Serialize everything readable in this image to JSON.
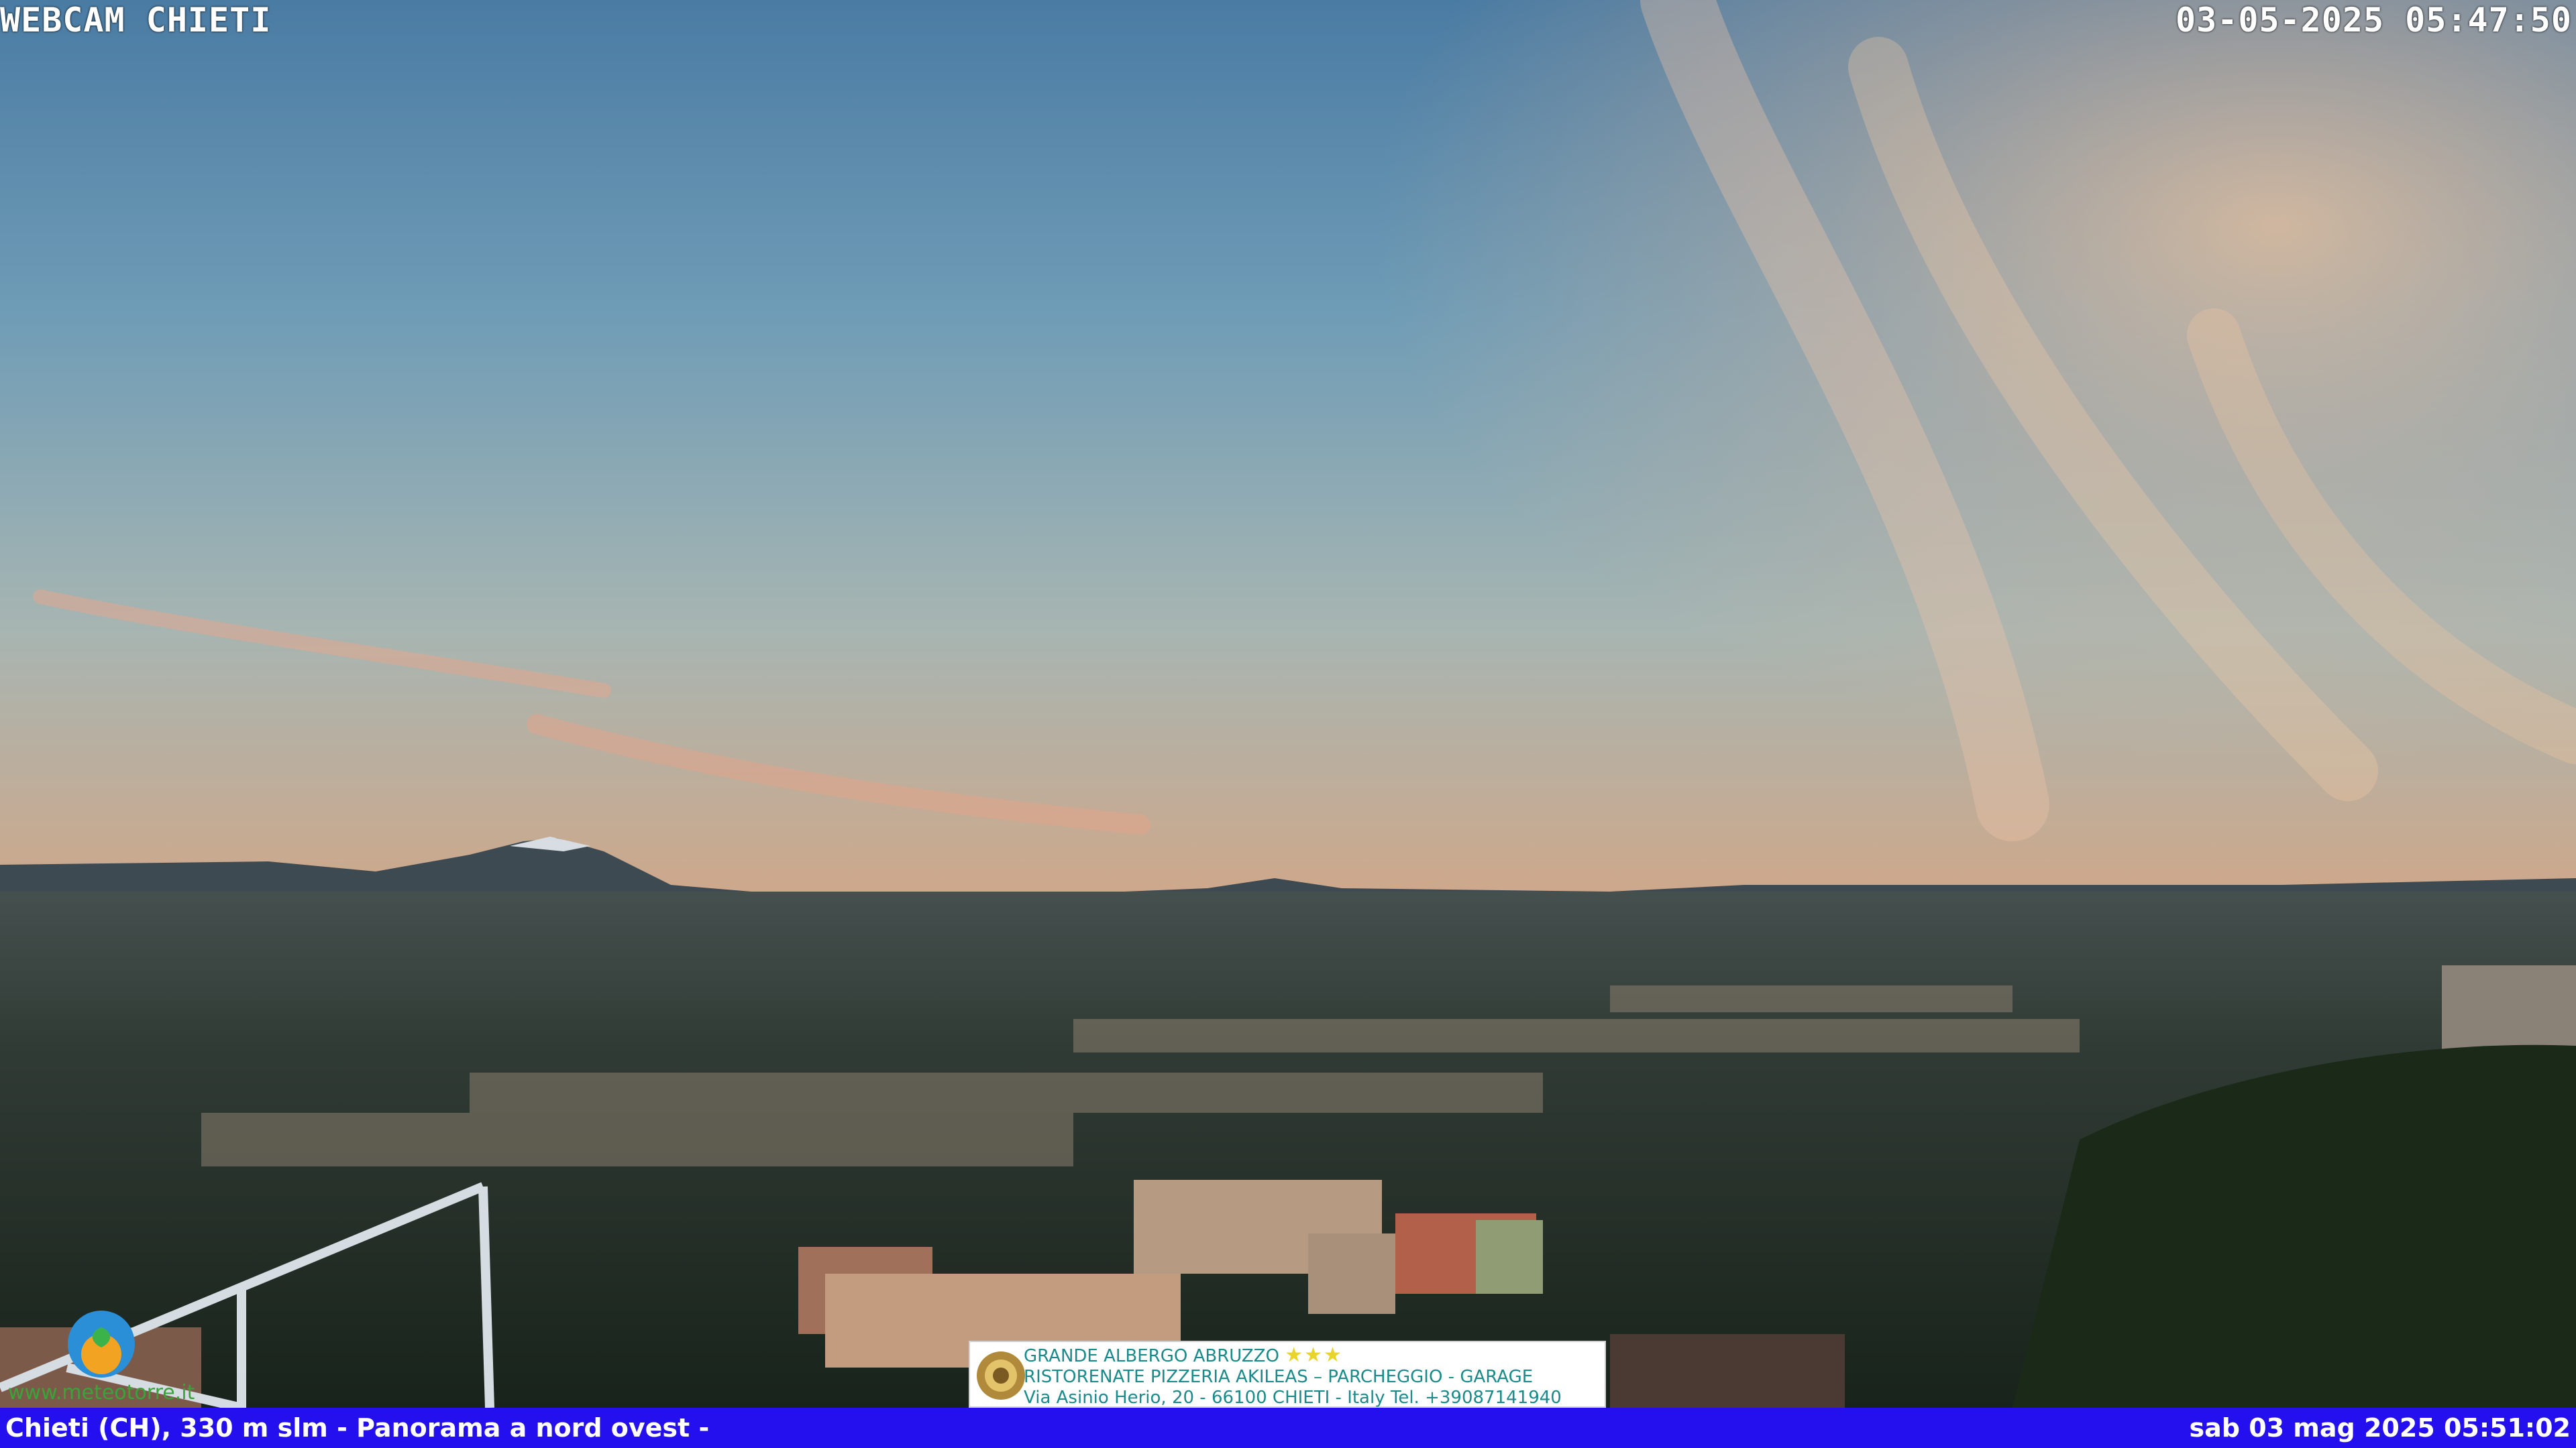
{
  "overlay": {
    "title": "WEBCAM CHIETI",
    "timestamp": "03-05-2025 05:47:50"
  },
  "footer": {
    "location": "Chieti (CH), 330 m slm - Panorama a nord ovest -",
    "datetime": "sab 03 mag 2025 05:51:02"
  },
  "banner": {
    "line1": "GRANDE ALBERGO ABRUZZO",
    "stars": "★★★",
    "line2": "RISTORENATE PIZZERIA AKILEAS – PARCHEGGIO - GARAGE",
    "line3": "Via Asinio Herio, 20 - 66100 CHIETI - Italy Tel. +39087141940"
  },
  "watermark": {
    "url": "www.meteotorre.it"
  },
  "colors": {
    "footer_bar": "#2410ee",
    "banner_text": "#1a8a8a",
    "sky_top": "#4e7fa6",
    "sky_horizon": "#d9b08a"
  }
}
